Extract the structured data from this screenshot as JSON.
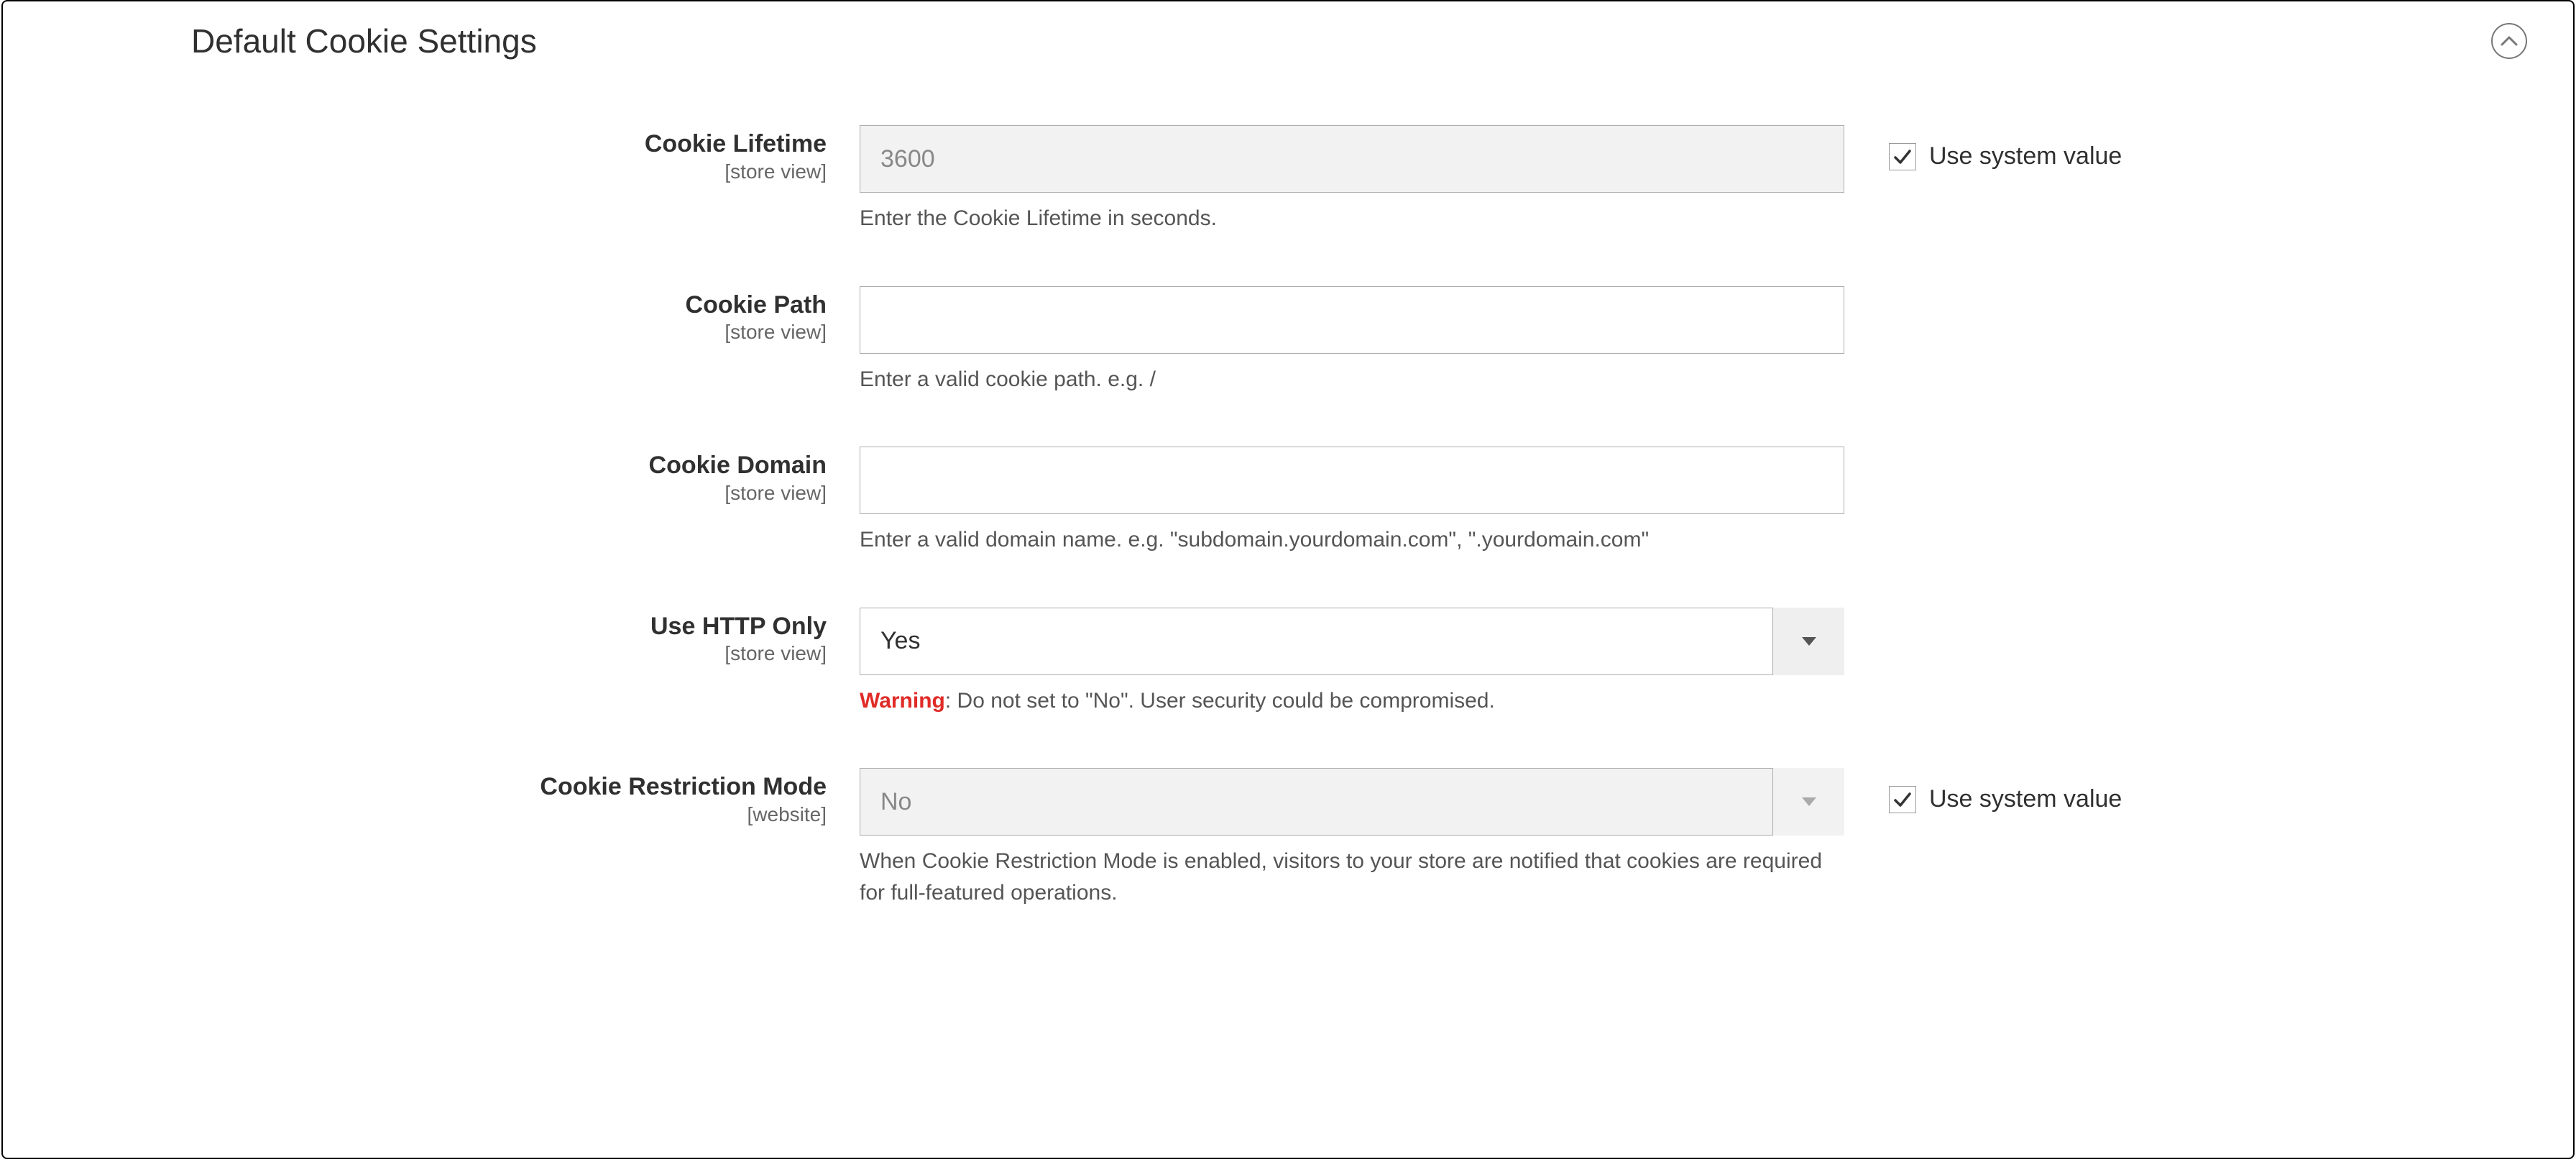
{
  "section_title": "Default Cookie Settings",
  "use_system_label": "Use system value",
  "scope_store_view": "[store view]",
  "scope_website": "[website]",
  "fields": {
    "lifetime": {
      "label": "Cookie Lifetime",
      "value": "3600",
      "hint": "Enter the Cookie Lifetime in seconds.",
      "use_system": true
    },
    "path": {
      "label": "Cookie Path",
      "value": "",
      "hint": "Enter a valid cookie path. e.g. /"
    },
    "domain": {
      "label": "Cookie Domain",
      "value": "",
      "hint": "Enter a valid domain name. e.g. \"subdomain.yourdomain.com\", \".yourdomain.com\""
    },
    "http_only": {
      "label": "Use HTTP Only",
      "value": "Yes",
      "hint_prefix": "Warning",
      "hint_rest": ": Do not set to \"No\". User security could be compromised."
    },
    "restriction": {
      "label": "Cookie Restriction Mode",
      "value": "No",
      "hint": "When Cookie Restriction Mode is enabled, visitors to your store are notified that cookies are required for full-featured operations.",
      "use_system": true
    }
  }
}
